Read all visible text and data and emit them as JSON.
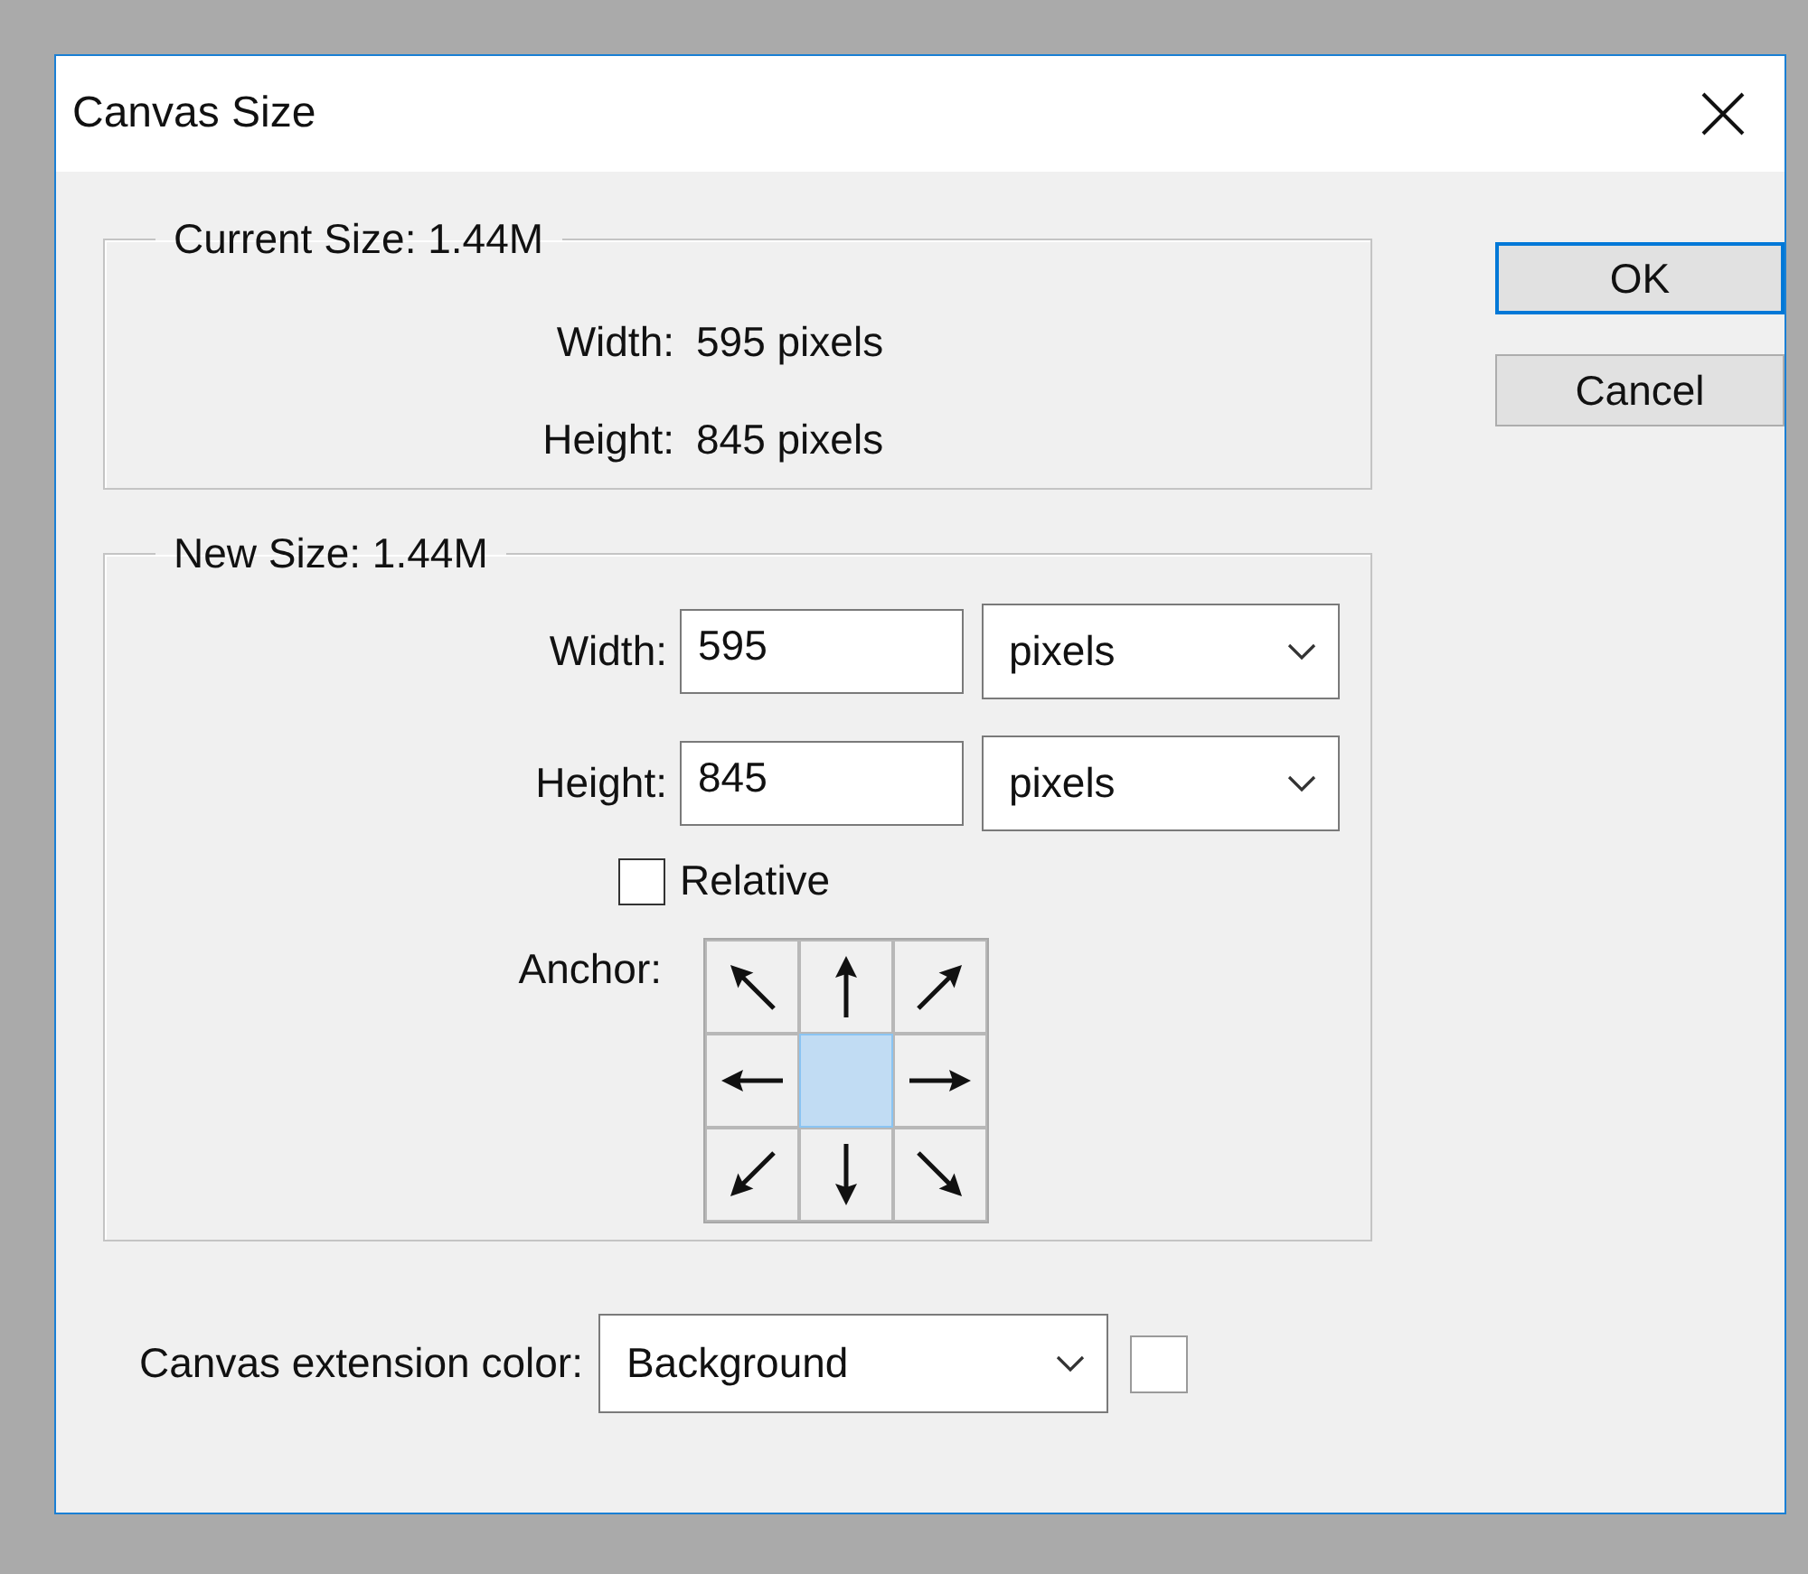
{
  "window": {
    "title": "Canvas Size"
  },
  "current_size": {
    "legend": "Current Size: 1.44M",
    "rows": [
      {
        "label": "Width:",
        "value": "595 pixels"
      },
      {
        "label": "Height:",
        "value": "845 pixels"
      }
    ]
  },
  "new_size": {
    "legend": "New Size: 1.44M",
    "fields": [
      {
        "label": "Width:",
        "value": "595",
        "unit": "pixels"
      },
      {
        "label": "Height:",
        "value": "845",
        "unit": "pixels"
      }
    ],
    "relative": {
      "label": "Relative",
      "checked": false
    },
    "anchor": {
      "label": "Anchor:",
      "cells": [
        {
          "selected": false
        },
        {
          "selected": false
        },
        {
          "selected": false
        },
        {
          "selected": false
        },
        {
          "selected": true
        },
        {
          "selected": false
        },
        {
          "selected": false
        },
        {
          "selected": false
        },
        {
          "selected": false
        }
      ]
    }
  },
  "extension_color": {
    "label": "Canvas extension color:",
    "value": "Background"
  },
  "buttons": [
    {
      "label": "OK",
      "default": true
    },
    {
      "label": "Cancel",
      "default": false
    }
  ]
}
